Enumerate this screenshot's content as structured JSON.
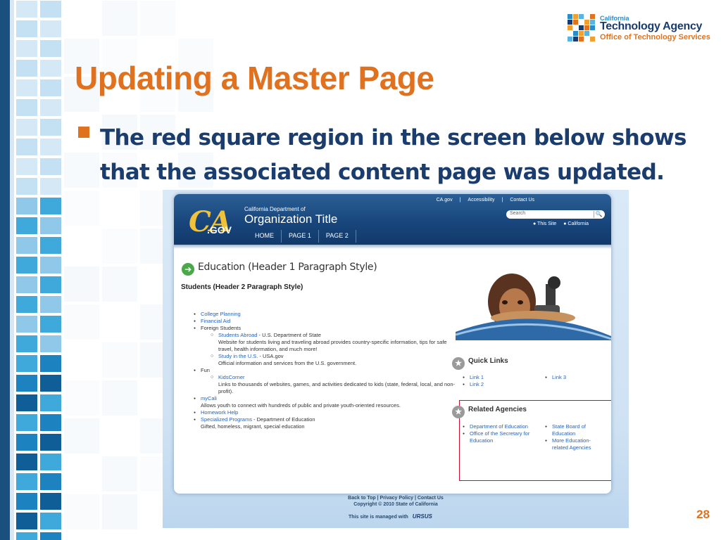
{
  "slide": {
    "title": "Updating a Master Page",
    "bullet": "The red square region in the screen below shows that the associated content page was updated.",
    "page_number": "28",
    "accent_color": "#e0721f",
    "text_color": "#1a3d6e"
  },
  "logo": {
    "line1": "California",
    "line2": "Technology Agency",
    "line3": "Office of Technology Services"
  },
  "screenshot": {
    "utility_links": [
      "CA.gov",
      "|",
      "Accessibility",
      "|",
      "Contact Us"
    ],
    "ca_logo": {
      "ca": "CA",
      "gov": ".GOV"
    },
    "department": "California Department of",
    "org_title": "Organization Title",
    "search": {
      "placeholder": "Search",
      "button": "🔍"
    },
    "scope": [
      "● This Site",
      "● California"
    ],
    "nav": [
      "HOME",
      "PAGE 1",
      "PAGE 2"
    ],
    "heading1": "Education (Header 1 Paragraph Style)",
    "heading2": "Students (Header 2 Paragraph Style)",
    "content": {
      "college_planning": "College Planning",
      "financial_aid": "Financial Aid",
      "foreign_students": "Foreign Students",
      "students_abroad_link": "Students Abroad",
      "students_abroad_rest": " - U.S. Department of State",
      "students_abroad_desc": "Website for students living and traveling abroad provides country-specific information, tips for safe travel, health information, and much more!",
      "study_link": "Study in the U.S.",
      "study_rest": " - USA.gov",
      "study_desc": "Official information and services from the U.S. government.",
      "fun": "Fun",
      "kidscorner_link": "KidsCorner",
      "kidscorner_desc": "Links to thousands of websites, games, and activities dedicated to kids (state, federal, local, and non-profit).",
      "mycali_link": "myCali",
      "mycali_desc": "Allows youth to connect with hundreds of public and private youth-oriented resources.",
      "homework_link": "Homework Help",
      "specialized_link": "Specialized Programs",
      "specialized_rest": " - Department of Education",
      "specialized_desc": "Gifted, homeless, migrant, special education"
    },
    "quick_links": {
      "title": "Quick Links",
      "col1": [
        "Link 1",
        "Link 2"
      ],
      "col2": [
        "Link 3"
      ]
    },
    "related_agencies": {
      "title": "Related Agencies",
      "col1": [
        "Department of Education",
        "Office of the Secretary for Education"
      ],
      "col2": [
        "State Board of Education",
        "More Education-related Agencies"
      ]
    },
    "footer": {
      "links": "Back to Top  |  Privacy Policy  |  Contact Us",
      "copyright": "Copyright © 2010 State of California",
      "managed": "This site is managed with",
      "ursus": "URSUS"
    }
  }
}
